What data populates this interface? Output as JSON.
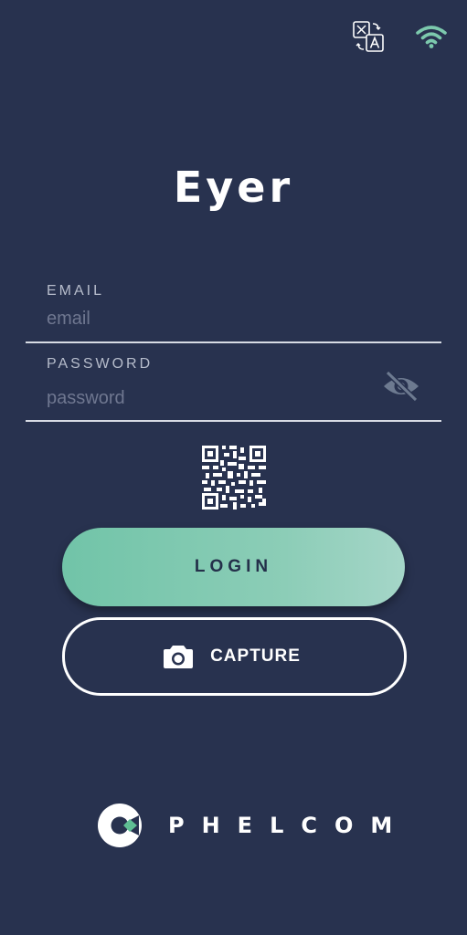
{
  "app": {
    "title": "Eyer"
  },
  "header": {
    "icons": [
      "translate-icon",
      "wifi-icon"
    ]
  },
  "login_form": {
    "email": {
      "label": "EMAIL",
      "value": "",
      "placeholder": "email"
    },
    "password": {
      "label": "PASSWORD",
      "value": "",
      "placeholder": "password",
      "visibility_icon": "eye-off-icon"
    },
    "qr_icon": "qr-code-icon",
    "login_label": "LOGIN",
    "capture_label": "CAPTURE",
    "capture_icon": "camera-icon"
  },
  "brand": {
    "name": "PHELCOM",
    "logo_icon": "phelcom-logo"
  },
  "colors": {
    "background": "#28324f",
    "accent": "#71c4a8",
    "accent_light": "#a5d6c8",
    "text_primary": "#ffffff",
    "label": "#b6bccb",
    "placeholder": "#6f7790"
  }
}
